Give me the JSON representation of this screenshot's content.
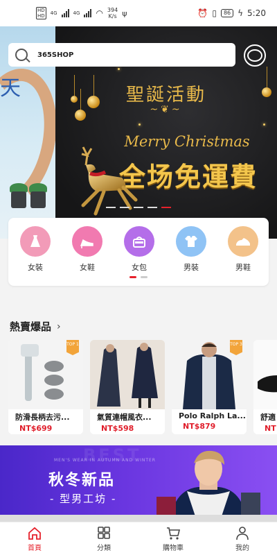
{
  "status_bar": {
    "net1": "4G",
    "net2": "4G",
    "speed_value": "394",
    "speed_unit": "K/s",
    "battery": "86",
    "time": "5:20"
  },
  "search": {
    "value": "365SHOP"
  },
  "banner": {
    "side_glyph": "天",
    "title": "聖誕活動",
    "subtitle_en": "Merry Christmas",
    "headline": "全场免運費",
    "slide_count": 5,
    "active_slide": 5
  },
  "categories": [
    {
      "label": "女裝",
      "icon": "dress-icon",
      "color": "#f29bb8"
    },
    {
      "label": "女鞋",
      "icon": "heel-shoe-icon",
      "color": "#f17ab0"
    },
    {
      "label": "女包",
      "icon": "handbag-icon",
      "color": "#b46ee9"
    },
    {
      "label": "男裝",
      "icon": "shirt-icon",
      "color": "#8fc3f5"
    },
    {
      "label": "男鞋",
      "icon": "mens-shoe-icon",
      "color": "#f3c28a"
    }
  ],
  "hot": {
    "title": "熱賣爆品",
    "products": [
      {
        "name": "防滑長柄去污...",
        "price": "NT$699",
        "badge": "TOP 1"
      },
      {
        "name": "氣質連帽風衣...",
        "price": "NT$598",
        "badge": ""
      },
      {
        "name": "Polo Ralph La...",
        "price": "NT$879",
        "badge": "TOP 3"
      },
      {
        "name": "舒適",
        "price": "NT",
        "badge": ""
      }
    ]
  },
  "promo": {
    "bg_text": "BEST",
    "en": "MEN'S WEAR IN AUTUMN AND WINTER",
    "title": "秋冬新品",
    "subtitle": "- 型男工坊 -"
  },
  "nav": [
    {
      "label": "首頁",
      "icon": "home-icon",
      "active": true
    },
    {
      "label": "分類",
      "icon": "grid-icon",
      "active": false
    },
    {
      "label": "購物車",
      "icon": "cart-icon",
      "active": false
    },
    {
      "label": "我的",
      "icon": "user-icon",
      "active": false
    }
  ],
  "colors": {
    "accent": "#e6212b",
    "gold": "#e8b94a",
    "promo": "#5a2fd6"
  }
}
